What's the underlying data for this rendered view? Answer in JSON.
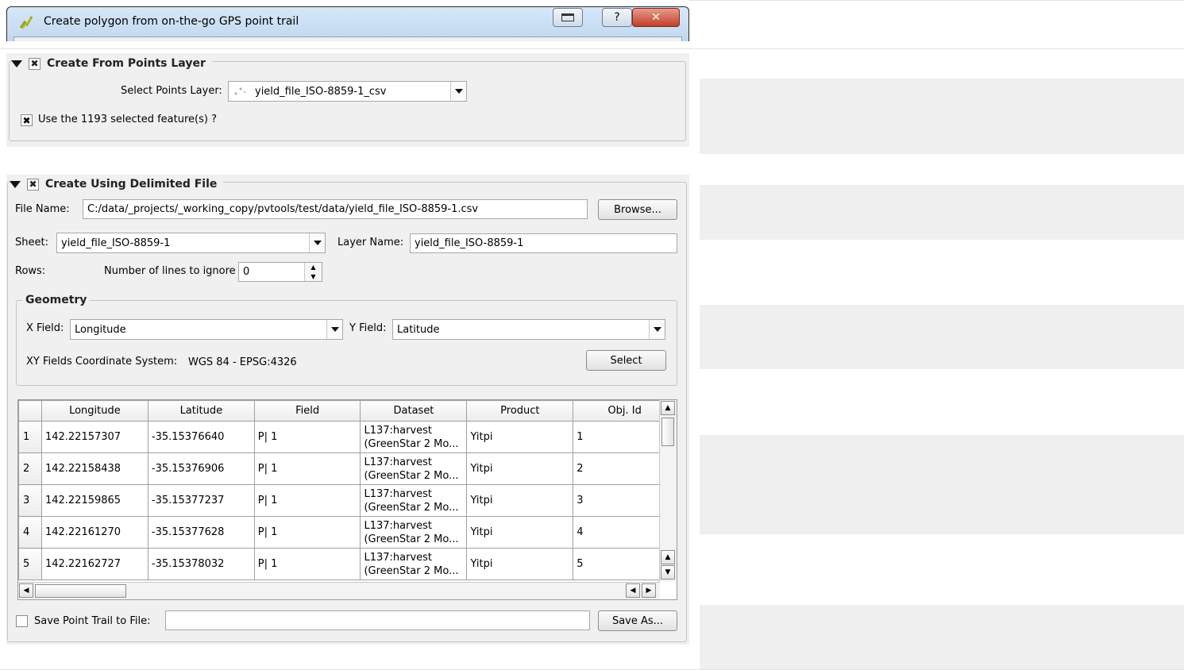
{
  "window": {
    "title": "Create polygon from on-the-go GPS point trail",
    "help_glyph": "?",
    "close_glyph": "✕"
  },
  "points_group": {
    "title": "Create From Points Layer",
    "checked_glyph": "✖",
    "select_label": "Select Points Layer:",
    "select_value": "yield_file_ISO-8859-1_csv",
    "use_selected_label": "Use the 1193 selected feature(s) ?"
  },
  "file_group": {
    "title": "Create Using Delimited File",
    "checked_glyph": "✖",
    "file_name_label": "File Name:",
    "file_name_value": "C:/data/_projects/_working_copy/pvtools/test/data/yield_file_ISO-8859-1.csv",
    "browse_label": "Browse...",
    "sheet_label": "Sheet:",
    "sheet_value": "yield_file_ISO-8859-1",
    "layer_name_label": "Layer Name:",
    "layer_name_value": "yield_file_ISO-8859-1",
    "rows_label": "Rows:",
    "ignore_label": "Number of lines to ignore",
    "ignore_value": "0",
    "geometry": {
      "title": "Geometry",
      "x_label": "X Field:",
      "x_value": "Longitude",
      "y_label": "Y Field:",
      "y_value": "Latitude",
      "crs_label": "XY Fields Coordinate System:",
      "crs_value": "WGS 84  -  EPSG:4326",
      "select_label": "Select"
    },
    "table": {
      "headers": [
        "Longitude",
        "Latitude",
        "Field",
        "Dataset",
        "Product",
        "Obj. Id"
      ],
      "rows": [
        {
          "n": "1",
          "lon": "142.22157307",
          "lat": "-35.15376640",
          "field": "P| 1",
          "ds1": "L137:harvest",
          "ds2": "(GreenStar 2 Mo...",
          "product": "Yitpi",
          "obj": "1"
        },
        {
          "n": "2",
          "lon": "142.22158438",
          "lat": "-35.15376906",
          "field": "P| 1",
          "ds1": "L137:harvest",
          "ds2": "(GreenStar 2 Mo...",
          "product": "Yitpi",
          "obj": "2"
        },
        {
          "n": "3",
          "lon": "142.22159865",
          "lat": "-35.15377237",
          "field": "P| 1",
          "ds1": "L137:harvest",
          "ds2": "(GreenStar 2 Mo...",
          "product": "Yitpi",
          "obj": "3"
        },
        {
          "n": "4",
          "lon": "142.22161270",
          "lat": "-35.15377628",
          "field": "P| 1",
          "ds1": "L137:harvest",
          "ds2": "(GreenStar 2 Mo...",
          "product": "Yitpi",
          "obj": "4"
        },
        {
          "n": "5",
          "lon": "142.22162727",
          "lat": "-35.15378032",
          "field": "P| 1",
          "ds1": "L137:harvest",
          "ds2": "(GreenStar 2 Mo...",
          "product": "Yitpi",
          "obj": "5"
        }
      ]
    },
    "save_label": "Save Point Trail to File:",
    "save_value": "",
    "save_as_label": "Save As..."
  }
}
